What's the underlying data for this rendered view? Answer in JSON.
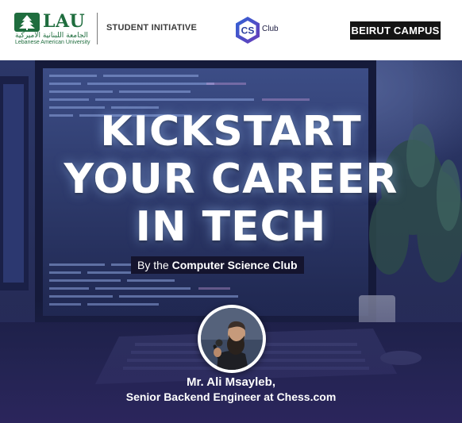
{
  "header": {
    "university_name": "LAU",
    "university_arabic": "الجامعة اللبنانية الأميركية",
    "university_full": "Lebanese American University",
    "initiative_label": "STUDENT INITIATIVE",
    "club_logo_letters": "CS",
    "club_logo_word": "Club",
    "campus_label": "BEIRUT CAMPUS"
  },
  "hero": {
    "headline_line1": "KICKSTART",
    "headline_line2": "YOUR CAREER",
    "headline_line3": "IN TECH",
    "byline_prefix": "By the",
    "byline_org": "Computer Science Club"
  },
  "speaker": {
    "name": "Mr. Ali Msayleb,",
    "title": "Senior Backend Engineer at Chess.com"
  },
  "colors": {
    "lau_green": "#1f6d3e",
    "cs_blue": "#2c4fbf",
    "cs_purple": "#5b3fb3",
    "hero_navy": "#27305c",
    "badge_black": "#141414"
  },
  "icons": {
    "lau_logo": "cedar-tree-icon",
    "club_logo": "hexagon-cs-icon"
  }
}
